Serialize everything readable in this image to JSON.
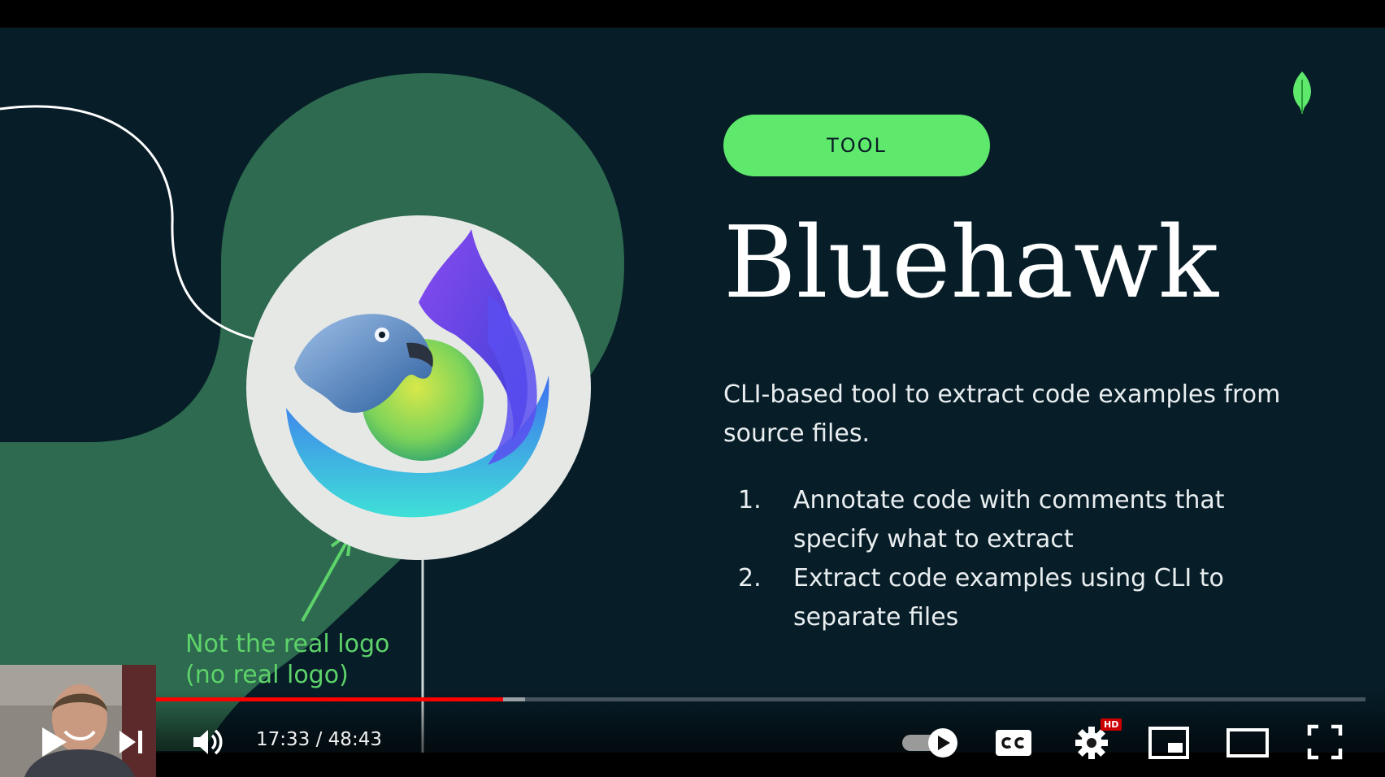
{
  "slide": {
    "tag_label": "TOOL",
    "title": "Bluehawk",
    "description": "CLI-based tool to extract code examples from source files.",
    "steps": [
      {
        "number": "1.",
        "text": "Annotate code with comments that specify what to extract"
      },
      {
        "number": "2.",
        "text": "Extract code examples using CLI to separate files"
      }
    ],
    "annotation": {
      "line1": "Not the real logo",
      "line2": "(no real logo)"
    },
    "colors": {
      "background": "#071d28",
      "blob": "#2d6a4f",
      "pill": "#5ee86c",
      "annotation": "#5ed36a",
      "leaf": "#5ee86c"
    },
    "icons": {
      "brand": "leaf-icon",
      "logo": "bluehawk-logo"
    }
  },
  "player": {
    "time_current": "17:33",
    "time_separator": "/",
    "time_total": "48:43",
    "progress_played": 0.361,
    "progress_buffered": 0.377,
    "hd_badge": "HD",
    "autoplay_on": true,
    "accent_color": "#ff0000",
    "buttons": {
      "play": "play-icon",
      "next": "next-icon",
      "volume": "volume-icon",
      "autoplay": "autoplay-toggle-icon",
      "captions": "cc-icon",
      "settings": "gear-icon",
      "miniplayer": "miniplayer-icon",
      "theater": "theater-icon",
      "fullscreen": "fullscreen-icon"
    }
  }
}
